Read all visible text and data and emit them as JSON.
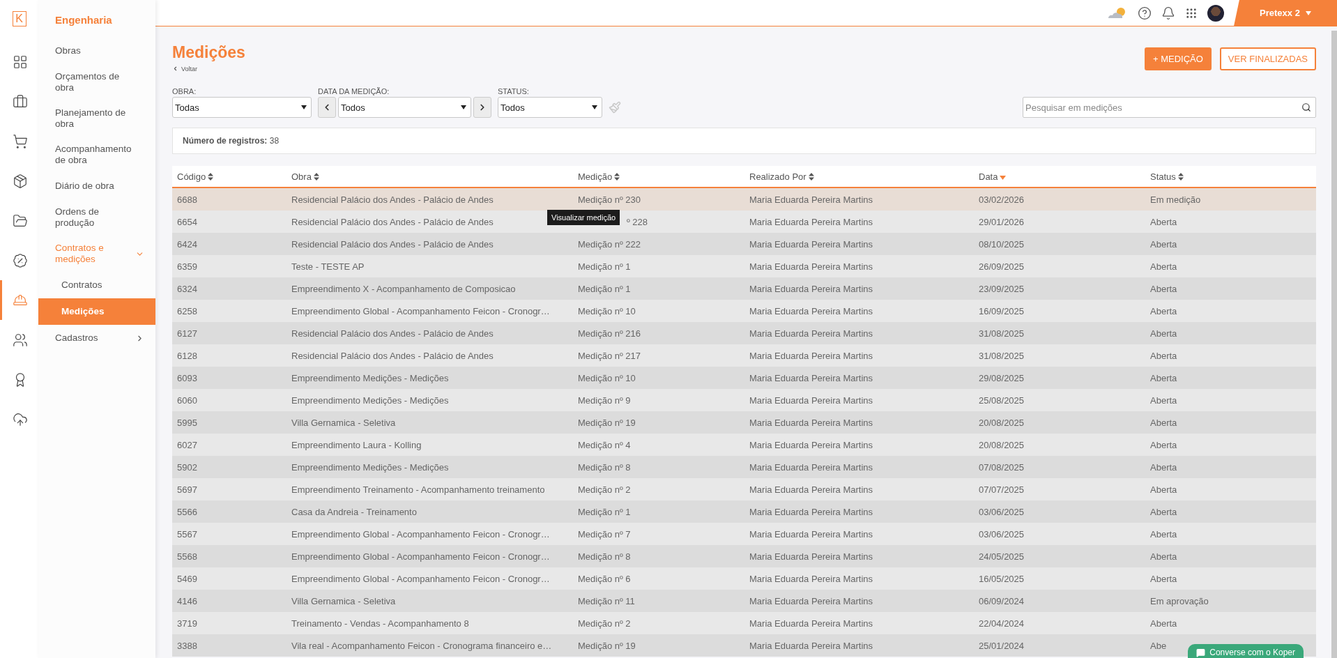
{
  "logo": "K",
  "rail": [
    {
      "kind": "dashboard",
      "selected": false
    },
    {
      "kind": "briefcase",
      "selected": false
    },
    {
      "kind": "cart",
      "selected": false
    },
    {
      "kind": "box",
      "selected": false
    },
    {
      "kind": "folder",
      "selected": false
    },
    {
      "kind": "percent",
      "selected": false
    },
    {
      "kind": "worker",
      "selected": true
    },
    {
      "kind": "people",
      "selected": false
    },
    {
      "kind": "award",
      "selected": false
    },
    {
      "kind": "upload",
      "selected": false
    }
  ],
  "menu": {
    "title": "Engenharia",
    "items": [
      {
        "label": "Obras",
        "selected": false
      },
      {
        "label": "Orçamentos de obra",
        "selected": false
      },
      {
        "label": "Planejamento de obra",
        "selected": false
      },
      {
        "label": "Acompanhamento de obra",
        "selected": false
      },
      {
        "label": "Diário de obra",
        "selected": false
      },
      {
        "label": "Ordens de produção",
        "selected": false
      },
      {
        "label": "Contratos e medições",
        "selected": false,
        "expanded": true,
        "children": [
          {
            "label": "Contratos",
            "selected": false
          },
          {
            "label": "Medições",
            "selected": true
          }
        ]
      },
      {
        "label": "Cadastros",
        "selected": false,
        "expanded": false
      }
    ]
  },
  "topbar": {
    "account": "Pretexx 2"
  },
  "page": {
    "title": "Medições",
    "back": "Voltar",
    "buttons": [
      {
        "label": "+ MEDIÇÃO",
        "kind": "primary"
      },
      {
        "label": "VER FINALIZADAS",
        "kind": "outline"
      }
    ]
  },
  "filters": [
    {
      "label": "OBRA:",
      "value": "Todas",
      "kind": "select"
    },
    {
      "label": "DATA DA MEDIÇÃO:",
      "value": "Todos",
      "kind": "date"
    },
    {
      "label": "STATUS:",
      "value": "Todos",
      "kind": "select"
    }
  ],
  "search": {
    "placeholder": "Pesquisar em medições"
  },
  "records": {
    "label": "Número de registros:",
    "value": "38"
  },
  "table": {
    "columns": [
      {
        "label": "Código",
        "sorted": false
      },
      {
        "label": "Obra",
        "sorted": false
      },
      {
        "label": "Medição",
        "sorted": false
      },
      {
        "label": "Realizado Por",
        "sorted": false
      },
      {
        "label": "Data",
        "sorted": true
      },
      {
        "label": "Status",
        "sorted": false
      }
    ],
    "rows": [
      {
        "selected": true,
        "cells": [
          "6688",
          "Residencial Palácio dos Andes - Palácio de Andes",
          "Medição nº 230",
          "Maria Eduarda Pereira Martins",
          "03/02/2026",
          "Em medição"
        ]
      },
      {
        "selected": false,
        "tooltip": "Visualizar medição",
        "cells": [
          "6654",
          "Residencial Palácio dos Andes - Palácio de Andes",
          "º 228",
          "Maria Eduarda Pereira Martins",
          "29/01/2026",
          "Aberta"
        ]
      },
      {
        "selected": false,
        "cells": [
          "6424",
          "Residencial Palácio dos Andes - Palácio de Andes",
          "Medição nº 222",
          "Maria Eduarda Pereira Martins",
          "08/10/2025",
          "Aberta"
        ]
      },
      {
        "selected": false,
        "cells": [
          "6359",
          "Teste - TESTE AP",
          "Medição nº 1",
          "Maria Eduarda Pereira Martins",
          "26/09/2025",
          "Aberta"
        ]
      },
      {
        "selected": false,
        "cells": [
          "6324",
          "Empreendimento X - Acompanhamento de Composicao",
          "Medição nº 1",
          "Maria Eduarda Pereira Martins",
          "23/09/2025",
          "Aberta"
        ]
      },
      {
        "selected": false,
        "cells": [
          "6258",
          "Empreendimento Global - Acompanhamento Feicon - Cronogr…",
          "Medição nº 10",
          "Maria Eduarda Pereira Martins",
          "16/09/2025",
          "Aberta"
        ]
      },
      {
        "selected": false,
        "cells": [
          "6127",
          "Residencial Palácio dos Andes - Palácio de Andes",
          "Medição nº 216",
          "Maria Eduarda Pereira Martins",
          "31/08/2025",
          "Aberta"
        ]
      },
      {
        "selected": false,
        "cells": [
          "6128",
          "Residencial Palácio dos Andes - Palácio de Andes",
          "Medição nº 217",
          "Maria Eduarda Pereira Martins",
          "31/08/2025",
          "Aberta"
        ]
      },
      {
        "selected": false,
        "cells": [
          "6093",
          "Empreendimento Medições - Medições",
          "Medição nº 10",
          "Maria Eduarda Pereira Martins",
          "29/08/2025",
          "Aberta"
        ]
      },
      {
        "selected": false,
        "cells": [
          "6060",
          "Empreendimento Medições - Medições",
          "Medição nº 9",
          "Maria Eduarda Pereira Martins",
          "25/08/2025",
          "Aberta"
        ]
      },
      {
        "selected": false,
        "cells": [
          "5995",
          "Villa Gernamica - Seletiva",
          "Medição nº 19",
          "Maria Eduarda Pereira Martins",
          "20/08/2025",
          "Aberta"
        ]
      },
      {
        "selected": false,
        "cells": [
          "6027",
          "Empreendimento Laura - Kolling",
          "Medição nº 4",
          "Maria Eduarda Pereira Martins",
          "20/08/2025",
          "Aberta"
        ]
      },
      {
        "selected": false,
        "cells": [
          "5902",
          "Empreendimento Medições - Medições",
          "Medição nº 8",
          "Maria Eduarda Pereira Martins",
          "07/08/2025",
          "Aberta"
        ]
      },
      {
        "selected": false,
        "cells": [
          "5697",
          "Empreendimento Treinamento - Acompanhamento treinamento",
          "Medição nº 2",
          "Maria Eduarda Pereira Martins",
          "07/07/2025",
          "Aberta"
        ]
      },
      {
        "selected": false,
        "cells": [
          "5566",
          "Casa da Andreia - Treinamento",
          "Medição nº 1",
          "Maria Eduarda Pereira Martins",
          "03/06/2025",
          "Aberta"
        ]
      },
      {
        "selected": false,
        "cells": [
          "5567",
          "Empreendimento Global - Acompanhamento Feicon - Cronogr…",
          "Medição nº 7",
          "Maria Eduarda Pereira Martins",
          "03/06/2025",
          "Aberta"
        ]
      },
      {
        "selected": false,
        "cells": [
          "5568",
          "Empreendimento Global - Acompanhamento Feicon - Cronogr…",
          "Medição nº 8",
          "Maria Eduarda Pereira Martins",
          "24/05/2025",
          "Aberta"
        ]
      },
      {
        "selected": false,
        "cells": [
          "5469",
          "Empreendimento Global - Acompanhamento Feicon - Cronogr…",
          "Medição nº 6",
          "Maria Eduarda Pereira Martins",
          "16/05/2025",
          "Aberta"
        ]
      },
      {
        "selected": false,
        "cells": [
          "4146",
          "Villa Gernamica - Seletiva",
          "Medição nº 11",
          "Maria Eduarda Pereira Martins",
          "06/09/2024",
          "Em aprovação"
        ]
      },
      {
        "selected": false,
        "cells": [
          "3719",
          "Treinamento - Vendas - Acompanhamento 8",
          "Medição nº 2",
          "Maria Eduarda Pereira Martins",
          "22/04/2024",
          "Aberta"
        ]
      },
      {
        "selected": false,
        "cells": [
          "3388",
          "Vila real - Acompanhamento Feicon - Cronograma financeiro e…",
          "Medição nº 19",
          "Maria Eduarda Pereira Martins",
          "25/01/2024",
          "Abe"
        ]
      }
    ]
  },
  "chat": {
    "label": "Converse com o Koper"
  }
}
